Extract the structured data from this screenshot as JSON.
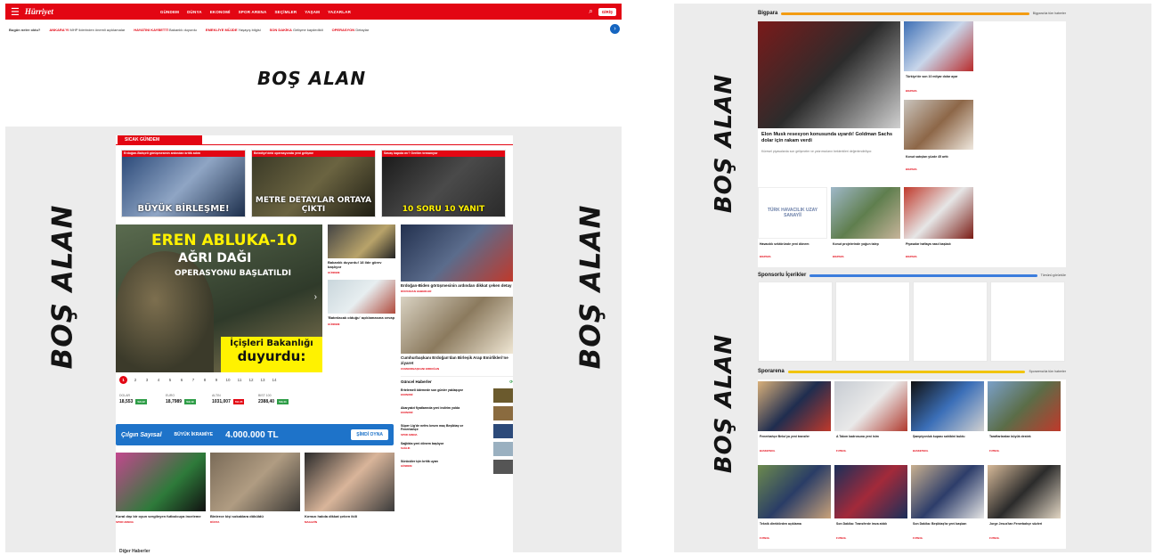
{
  "left": {
    "logo": "Hürriyet",
    "nav": [
      "GÜNDEM",
      "DÜNYA",
      "EKONOMİ",
      "SPOR ARENA",
      "SEÇİMLER",
      "YAŞAM",
      "YAZARLAR"
    ],
    "login": "GİRİŞ",
    "ticker": {
      "question": "Bugün neler oldu?",
      "items": [
        {
          "tag": "ANKARA'YI",
          "text": "MHP liderinden önemli açıklamalar"
        },
        {
          "tag": "HAYATINI KAYBETTİ",
          "text": "Bakanlık duyurdu"
        },
        {
          "tag": "EMEKLİYE MÜJDE",
          "text": "Yaşayış bilgisi"
        },
        {
          "tag": "SON DAKİKA",
          "text": "Gelişme kaydedildi"
        },
        {
          "tag": "OPERASYON",
          "text": "Detaylar"
        }
      ]
    },
    "bos_alan": "BOŞ ALAN",
    "sicak_gundem": "SICAK GÜNDEM",
    "headline_cards": [
      {
        "bar": "Erdoğan-Bahçeli görüşmesinin ardından kritik adım",
        "caption": "BÜYÜK BİRLEŞME!"
      },
      {
        "bar": "Belediye'deki operasyonda yeni gelişme",
        "caption": "METRE DETAYLAR ORTAYA ÇIKTI"
      },
      {
        "bar": "Savaş kapıda mı? Gerilim tırmanıyor",
        "caption": "10 SORU 10 YANIT"
      }
    ],
    "slider": {
      "line1": "EREN ABLUKA-10",
      "line2": "AĞRI DAĞI",
      "line3": "OPERASYONU BAŞLATILDI",
      "yellow1": "İçişleri Bakanlığı",
      "yellow2": "duyurdu:"
    },
    "pager": [
      "1",
      "2",
      "3",
      "4",
      "5",
      "6",
      "7",
      "8",
      "9",
      "10",
      "11",
      "12",
      "13",
      "14"
    ],
    "market": [
      {
        "name": "DOLAR",
        "value": "18,553",
        "chg": "%0,12",
        "dir": "up"
      },
      {
        "name": "EURO",
        "value": "18,7989",
        "chg": "%0,19",
        "dir": "up"
      },
      {
        "name": "ALTIN",
        "value": "1031,007",
        "chg": "%0,35",
        "dir": "down"
      },
      {
        "name": "BIST 100",
        "value": "2388,40",
        "chg": "%0,44",
        "dir": "up"
      }
    ],
    "mid_cards": [
      {
        "title": "Bakanlık duyurdu! 18 ilde görev başlıyor",
        "tag": "GÜNDEM"
      },
      {
        "title": "'Batırılacak olduğu' açıklamasına cevap",
        "tag": "GÜNDEM"
      }
    ],
    "right_cards": [
      {
        "title": "Erdoğan-Biden görüşmesinin ardından dikkat çeken detay",
        "tag": "DÜNYADAN HABERLER"
      },
      {
        "title": "Cumhurbaşkanı Erdoğan'dan Birleşik Arap Emirlikleri'ne ziyaret",
        "tag": "CUMHURBAŞKANI ERDOĞAN"
      }
    ],
    "guncel": {
      "title": "Güncel Haberler",
      "items": [
        {
          "title": "Ertelemeli ödemede son günler yaklaşıyor",
          "tag": "EKONOMİ"
        },
        {
          "title": "Akaryakıt fiyatlarında yeni indirim yolda",
          "tag": "EKONOMİ"
        },
        {
          "title": "Süper Lig'de nefes kesen maç Beşiktaş ve Fenerbahçe",
          "tag": "SPOR ARENA"
        },
        {
          "title": "Sağlıkta yeni dönem başlıyor",
          "tag": "SAĞLIK"
        },
        {
          "title": "Sürücüler için kritik uyarı",
          "tag": "GÜNDEM"
        }
      ]
    },
    "lotto": {
      "logo": "Çılgın Sayısal",
      "label": "BÜYÜK İKRAMİYE",
      "amount": "4.000.000 TL",
      "button": "ŞİMDİ OYNA"
    },
    "bottom_cards": [
      {
        "title": "Kural dışı bir oyun sergileyen futbolcuya inceleme",
        "tag": "SPOR ARENA"
      },
      {
        "title": "Binlerce kişi sokaklara döküldü",
        "tag": "DÜNYA"
      },
      {
        "title": "Kırmızı halıda dikkat çeken ikili",
        "tag": "MAGAZİN"
      }
    ],
    "more": "Diğer Haberler"
  },
  "right": {
    "bos_alan": "BOŞ ALAN",
    "bigpara": {
      "title": "Bigpara",
      "all": "Bigpara'da tüm haberler",
      "main_title": "Elon Musk resesyon konusunda uyardı! Goldman Sachs dolar için rakam verdi",
      "main_desc": "Küresel piyasalarda son gelişmeler ve yatırımcıların beklentileri değerlendiriliyor.",
      "cards": [
        {
          "title": "Türkiye'de son 10 milyar dolar ayar",
          "tag": "BIGPARA"
        },
        {
          "title": "Konut satışları yüzde 45 arttı",
          "tag": "BIGPARA"
        },
        {
          "title": "Havacılık sektöründe yeni dönem",
          "tag": "BIGPARA"
        },
        {
          "title": "Konut projelerinde yoğun talep",
          "tag": "BIGPARA"
        },
        {
          "title": "Piyasalar haftaya nasıl başladı",
          "tag": "BIGPARA"
        }
      ],
      "logo_text": "TÜRK HAVACILIK UZAY SANAYİİ"
    },
    "sponsor": {
      "title": "Sponsorlu İçerikler",
      "all": "Tümünü görüntüle"
    },
    "sporarena": {
      "title": "Sporarena",
      "all": "Sporarena'da tüm haberler",
      "cards": [
        {
          "title": "Fenerbahçe Beko'ya yeni transfer",
          "tag": "BASKETBOL"
        },
        {
          "title": "A Takım kadrosuna yeni isim",
          "tag": "FUTBOL"
        },
        {
          "title": "Şampiyonluk kupası sahibini buldu",
          "tag": "BASKETBOL"
        },
        {
          "title": "Taraftarlardan büyük destek",
          "tag": "FUTBOL"
        },
        {
          "title": "Teknik direktörden açıklama",
          "tag": "FUTBOL"
        },
        {
          "title": "Son Dakika: Transferde imza atıldı",
          "tag": "FUTBOL"
        },
        {
          "title": "Son Dakika: Beşiktaş'ta yeni başkan",
          "tag": "FUTBOL"
        },
        {
          "title": "Jorge Jesus'tan Fenerbahçe sözleri",
          "tag": "FUTBOL"
        }
      ]
    }
  },
  "colors": {
    "brand_red": "#e30613",
    "bigpara_line": "#f39c12",
    "sponsor_line": "#3b7ddd",
    "sporarena_line": "#f1c40f",
    "lotto_blue": "#1e73c9"
  }
}
